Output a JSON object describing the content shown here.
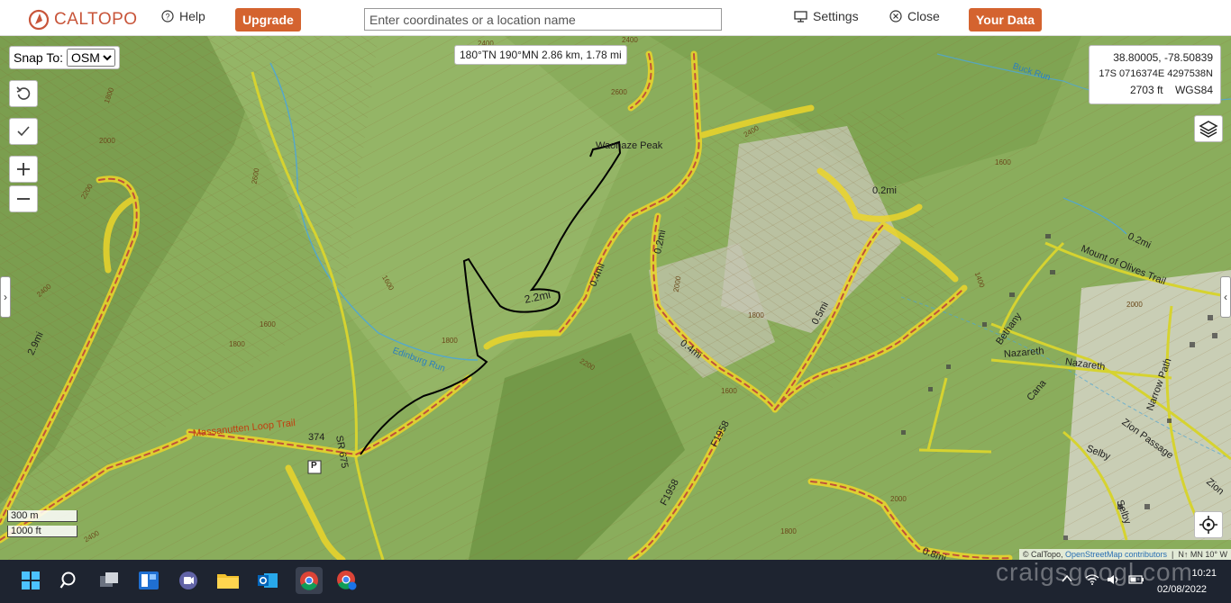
{
  "app": {
    "logo_text": "CALTOPO",
    "help_label": "Help",
    "upgrade_label": "Upgrade",
    "search_placeholder": "Enter coordinates or a location name",
    "settings_label": "Settings",
    "close_label": "Close",
    "your_data_label": "Your Data",
    "accent_color": "#d4632f"
  },
  "map": {
    "snap_label": "Snap To:",
    "snap_option": "OSM",
    "measure_text": "180°TN 190°MN 2.86 km, 1.78 mi",
    "coords": {
      "latlon": "38.80005, -78.50839",
      "utm": "17S 0716374E 4297538N",
      "elevation": "2703 ft",
      "datum": "WGS84"
    },
    "scale": {
      "metric": "300 m",
      "imperial": "1000 ft"
    },
    "attribution": {
      "caltopo": "© CalTopo,",
      "osm": "OpenStreetMap contributors",
      "declination": "N↑ MN 10° W"
    },
    "labels": {
      "peak": "Waonaze Peak",
      "route_distance": "2.2mi",
      "trail_massanutten": "Massanutten Loop Trail",
      "route_374": "374",
      "road_sr675": "SR 675",
      "stream_edinburg": "Edinburg Run",
      "stream_buck": "Buck Run",
      "trail_mount_olives": "Mount of Olives Trail",
      "road_bethany": "Bethany",
      "road_nazareth1": "Nazareth",
      "road_nazareth2": "Nazareth",
      "road_narrow": "Narrow Path",
      "road_cana": "Cana",
      "road_zion": "Zion Passage",
      "road_zion2": "Zion",
      "road_selby": "Selby",
      "road_selby2": "Selby",
      "road_f1958a": "F1958",
      "road_f1958b": "F1958",
      "dist_04a": "0.4mi",
      "dist_04b": "0.4mi",
      "dist_02a": "0.2mi",
      "dist_02b": "0.2mi",
      "dist_02c": "0.2mi",
      "dist_05": "0.5mi",
      "dist_29": "2.9mi",
      "dist_08": "0.8mi",
      "parking": "P",
      "contours": [
        "2400",
        "2600",
        "2400",
        "2000",
        "1800",
        "2200",
        "2400",
        "1600",
        "1800",
        "1600",
        "1800",
        "2200",
        "2400",
        "1600",
        "1800",
        "2000",
        "1600",
        "2000",
        "1400",
        "1800",
        "2200",
        "2400",
        "2600",
        "2000",
        "1400"
      ]
    }
  },
  "taskbar": {
    "time": "10:21",
    "date": "02/08/2022",
    "watermark": "craigsgoogl.com"
  }
}
